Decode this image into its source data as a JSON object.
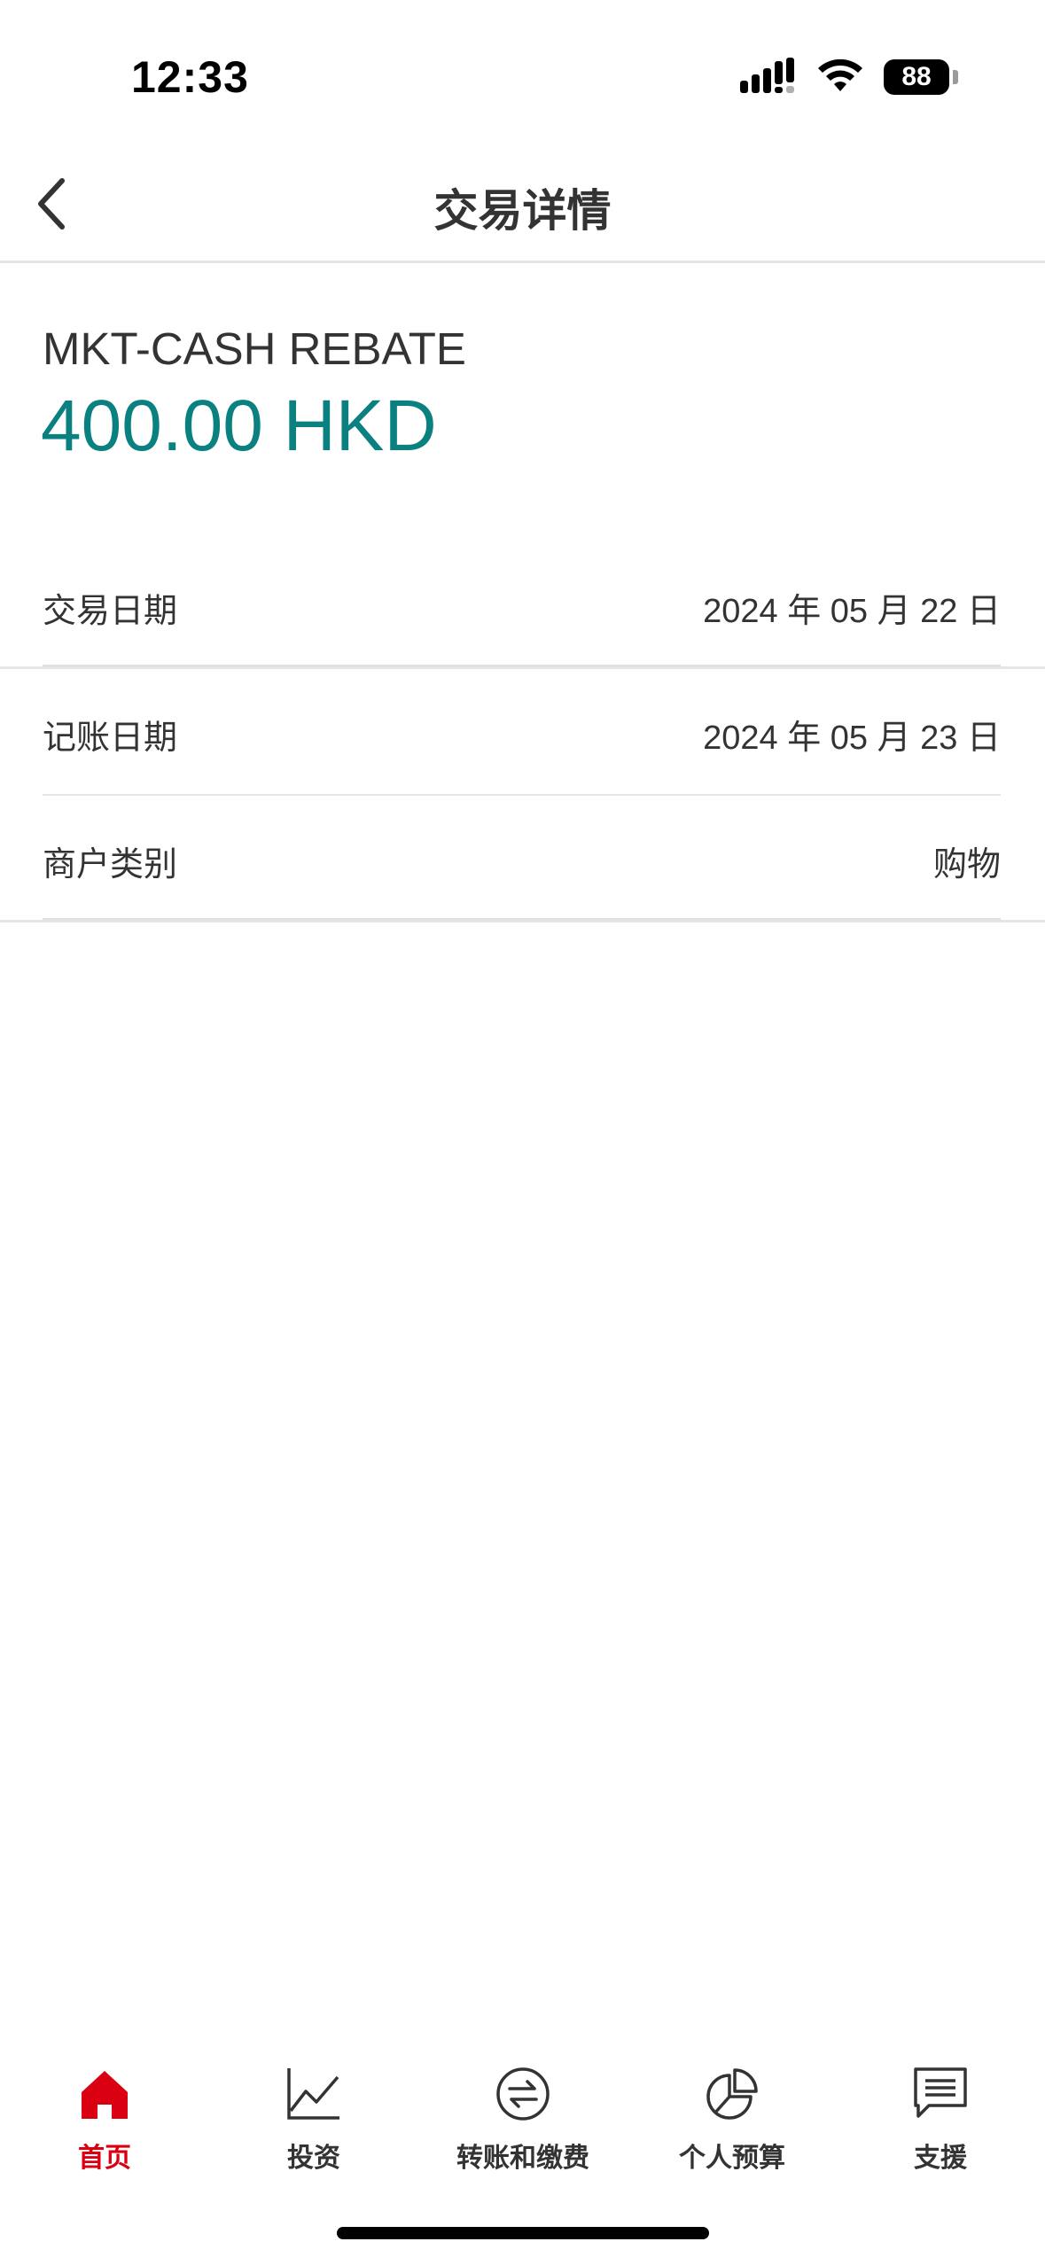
{
  "status_bar": {
    "time": "12:33",
    "battery": "88",
    "icons": [
      "signal-icon",
      "wifi-icon",
      "battery-icon"
    ]
  },
  "header": {
    "title": "交易详情",
    "back_icon": "chevron-left-icon"
  },
  "transaction": {
    "name": "MKT-CASH REBATE",
    "amount": "400.00 HKD",
    "amount_color": "#0a8080"
  },
  "details": [
    {
      "label": "交易日期",
      "value": "2024 年 05 月 22 日"
    },
    {
      "label": "记账日期",
      "value": "2024 年 05 月 23 日"
    },
    {
      "label": "商户类别",
      "value": "购物"
    }
  ],
  "tab_bar": {
    "active_color": "#db0011",
    "tabs": [
      {
        "label": "首页",
        "icon": "home-icon",
        "active": true
      },
      {
        "label": "投资",
        "icon": "line-chart-icon",
        "active": false
      },
      {
        "label": "转账和缴费",
        "icon": "transfer-icon",
        "active": false
      },
      {
        "label": "个人预算",
        "icon": "pie-chart-icon",
        "active": false
      },
      {
        "label": "支援",
        "icon": "chat-icon",
        "active": false
      }
    ]
  }
}
